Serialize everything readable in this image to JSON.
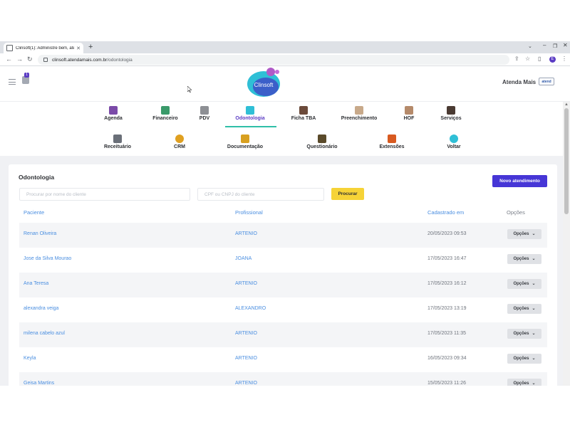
{
  "browser": {
    "tab_title": "Clinsoft(1): Administre bem, aten",
    "url_host": "clinsoft.atendamais.com.br",
    "url_path": "/odontologia",
    "profile_initial": "E"
  },
  "header": {
    "notification_count": "1",
    "brand_name": "Atenda Mais",
    "logo_text": "Clinsoft",
    "brand_logo_text": "atend",
    "accent_color": "#5b3cc4"
  },
  "modules_row1": [
    {
      "label": "Agenda",
      "icon": "calendar-icon"
    },
    {
      "label": "Financeiro",
      "icon": "finance-chart-icon"
    },
    {
      "label": "PDV",
      "icon": "cash-register-icon"
    },
    {
      "label": "Odontologia",
      "icon": "tooth-icon",
      "active": true
    },
    {
      "label": "Ficha TBA",
      "icon": "doctor-avatar-icon"
    },
    {
      "label": "Preenchimento",
      "icon": "face-avatar-icon"
    },
    {
      "label": "HOF",
      "icon": "hof-avatar-icon"
    },
    {
      "label": "Serviços",
      "icon": "professional-avatar-icon"
    }
  ],
  "modules_row2": [
    {
      "label": "Receituário",
      "icon": "prescription-icon"
    },
    {
      "label": "CRM",
      "icon": "crm-chrome-icon"
    },
    {
      "label": "Documentação",
      "icon": "documents-icon"
    },
    {
      "label": "Questionário",
      "icon": "questionnaire-icon"
    },
    {
      "label": "Extensões",
      "icon": "extensions-icon"
    },
    {
      "label": "Voltar",
      "icon": "back-arrow-icon"
    }
  ],
  "page": {
    "title": "Odontologia",
    "new_button": "Novo atendimento",
    "search_name_placeholder": "Procurar por nome do cliente",
    "search_cpf_placeholder": "CPF ou CNPJ do cliente",
    "search_button": "Procurar"
  },
  "table": {
    "headers": {
      "patient": "Paciente",
      "professional": "Profissional",
      "created": "Cadastrado em",
      "options": "Opções"
    },
    "option_label": "Opções",
    "rows": [
      {
        "patient": "Renan Oliveira",
        "professional": "ARTENIO",
        "created": "20/05/2023 09:53"
      },
      {
        "patient": "Jose da Silva Mourao",
        "professional": "JOANA",
        "created": "17/05/2023 16:47"
      },
      {
        "patient": "Ana Teresa",
        "professional": "ARTENIO",
        "created": "17/05/2023 16:12"
      },
      {
        "patient": "alexandra veiga",
        "professional": "ALEXANDRO",
        "created": "17/05/2023 13:19"
      },
      {
        "patient": "milena cabelo azul",
        "professional": "ARTENIO",
        "created": "17/05/2023 11:35"
      },
      {
        "patient": "Keyla",
        "professional": "ARTENIO",
        "created": "16/05/2023 09:34"
      },
      {
        "patient": "Geisa Martins",
        "professional": "ARTENIO",
        "created": "15/05/2023 11:26"
      }
    ]
  }
}
